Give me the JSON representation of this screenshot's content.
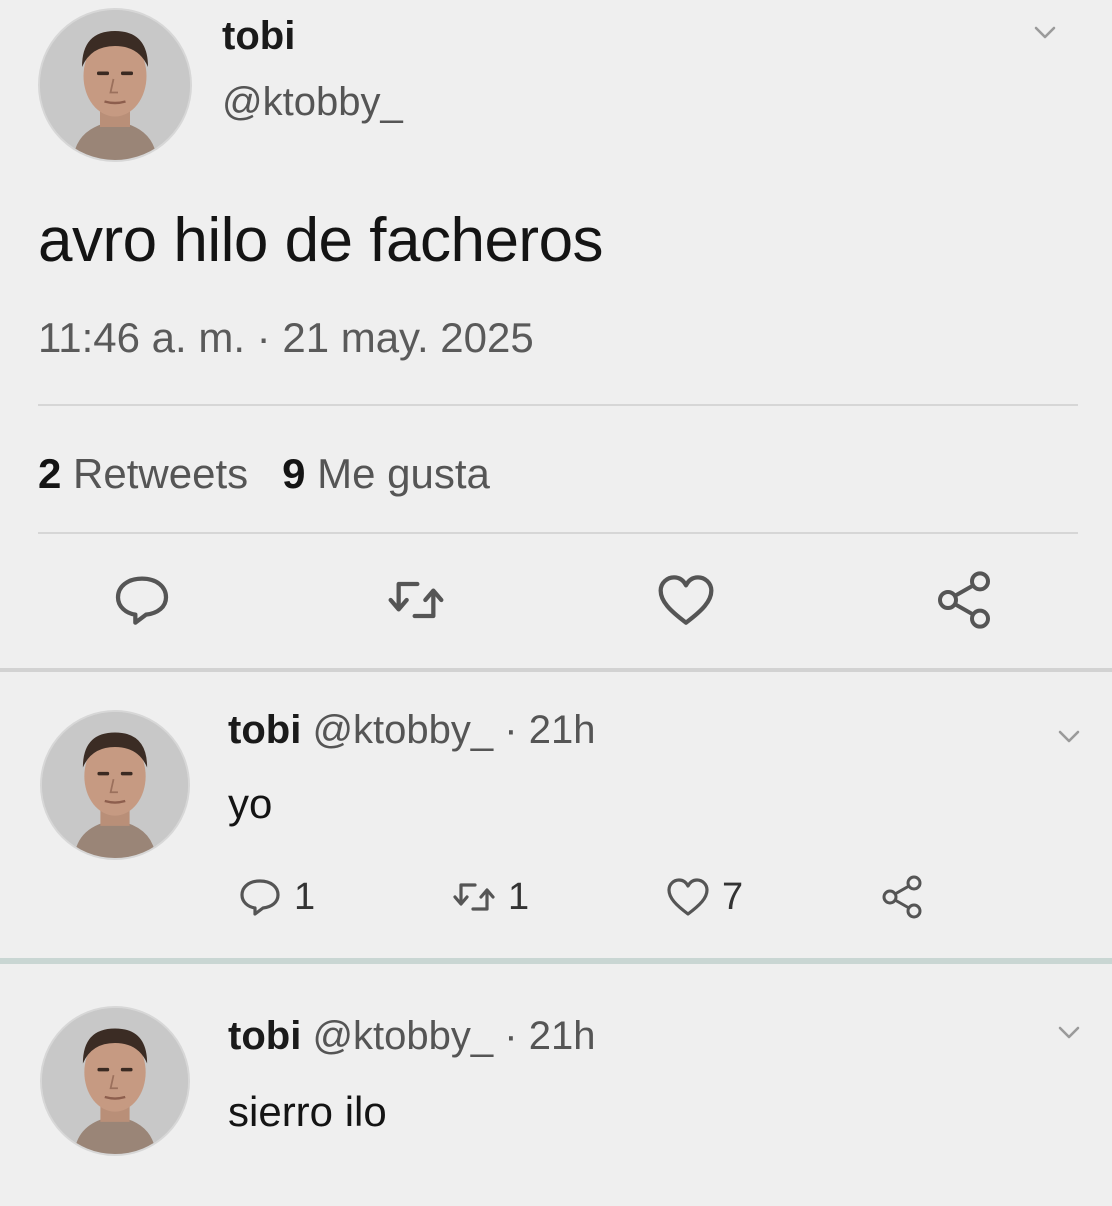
{
  "tweet": {
    "name": "tobi",
    "handle": "@ktobby_",
    "text": "avro hilo de facheros",
    "timestamp": "11:46 a. m. · 21 may. 2025",
    "retweets_count": "2",
    "retweets_label": "Retweets",
    "likes_count": "9",
    "likes_label": "Me gusta",
    "icons": [
      "reply-icon",
      "retweet-icon",
      "like-icon",
      "share-icon",
      "chevron-down-icon"
    ]
  },
  "replies": [
    {
      "name": "tobi",
      "handle": "@ktobby_",
      "time": "· 21h",
      "text": "yo",
      "reply_count": "1",
      "retweet_count": "1",
      "like_count": "7"
    },
    {
      "name": "tobi",
      "handle": "@ktobby_",
      "time": "· 21h",
      "text": "sierro ilo"
    }
  ],
  "colors": {
    "background": "#efefef",
    "text": "#141414",
    "secondary_text": "#555555",
    "icon": "#555555",
    "divider": "#d6d6d6"
  }
}
